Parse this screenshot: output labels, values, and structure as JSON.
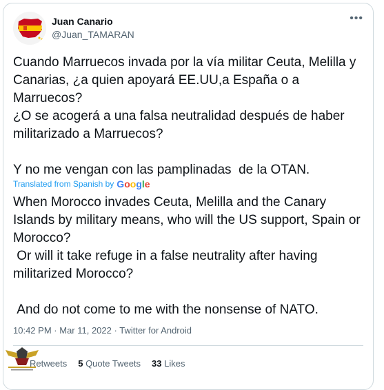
{
  "author": {
    "name": "Juan Canario",
    "handle": "@Juan_TAMARAN"
  },
  "tweet": {
    "text": "Cuando Marruecos invada por la vía militar Ceuta, Melilla y Canarias, ¿a quien apoyará EE.UU,a España o a Marruecos?\n¿O se acogerá a una falsa neutralidad después de haber militarizado a Marruecos?\n\nY no me vengan con las pamplinadas  de la OTAN.",
    "translated_label": "Translated from Spanish by",
    "translation_brand": "Google",
    "translated_text": "When Morocco invades Ceuta, Melilla and the Canary Islands by military means, who will the US support, Spain or Morocco?\n Or will it take refuge in a false neutrality after having militarized Morocco?\n\n And do not come to me with the nonsense of NATO."
  },
  "meta": {
    "time": "10:42 PM",
    "separator": "·",
    "date": "Mar 11, 2022",
    "source": "Twitter for Android"
  },
  "stats": {
    "retweets_label": "Retweets",
    "quote_count": "5",
    "quote_label": "Quote Tweets",
    "like_count": "33",
    "like_label": "Likes"
  },
  "colors": {
    "link_blue": "#1d9bf0",
    "secondary": "#536471",
    "border": "#cfd9de",
    "flag_red": "#c60b1e",
    "flag_yellow": "#ffc400"
  }
}
